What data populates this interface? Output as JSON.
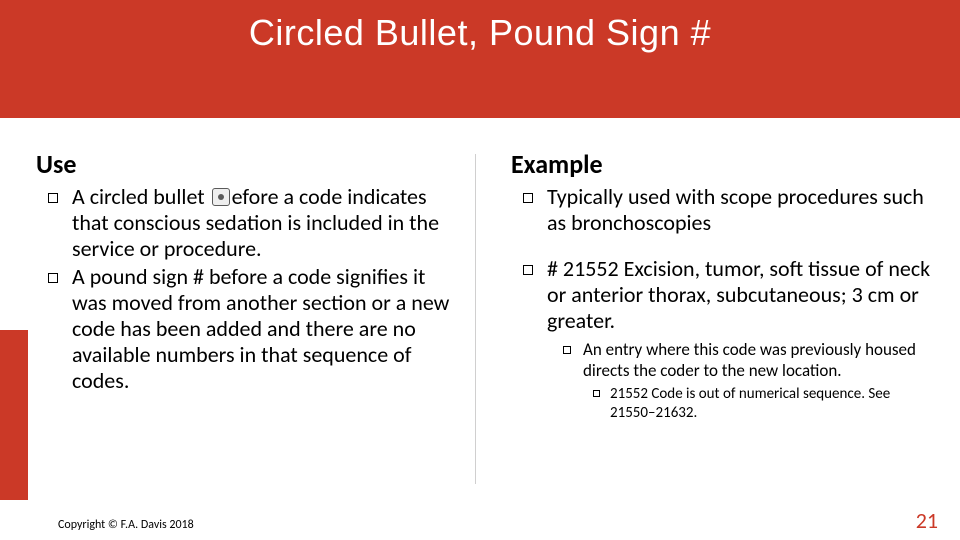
{
  "header": {
    "title": "Circled Bullet,  Pound Sign #"
  },
  "left": {
    "heading": "Use",
    "b1_pre": "A circled bullet ",
    "b1_post": "efore a code indicates that conscious sedation is included in the service or procedure.",
    "b2": "A pound sign # before a code signifies it was moved from another section or a new code has been added and there are no available numbers in that sequence of codes."
  },
  "right": {
    "heading": "Example",
    "b1": "Typically used with scope procedures such as bronchoscopies",
    "b2": "# 21552 Excision, tumor, soft tissue of neck or anterior thorax, subcutaneous; 3 cm or greater.",
    "b2a": "An entry where this code was previously housed directs the coder to the new location.",
    "b2a1": "21552 Code is out of numerical sequence. See 21550–21632."
  },
  "footer": {
    "copyright": "Copyright © F.A. Davis 2018",
    "page": "21"
  }
}
